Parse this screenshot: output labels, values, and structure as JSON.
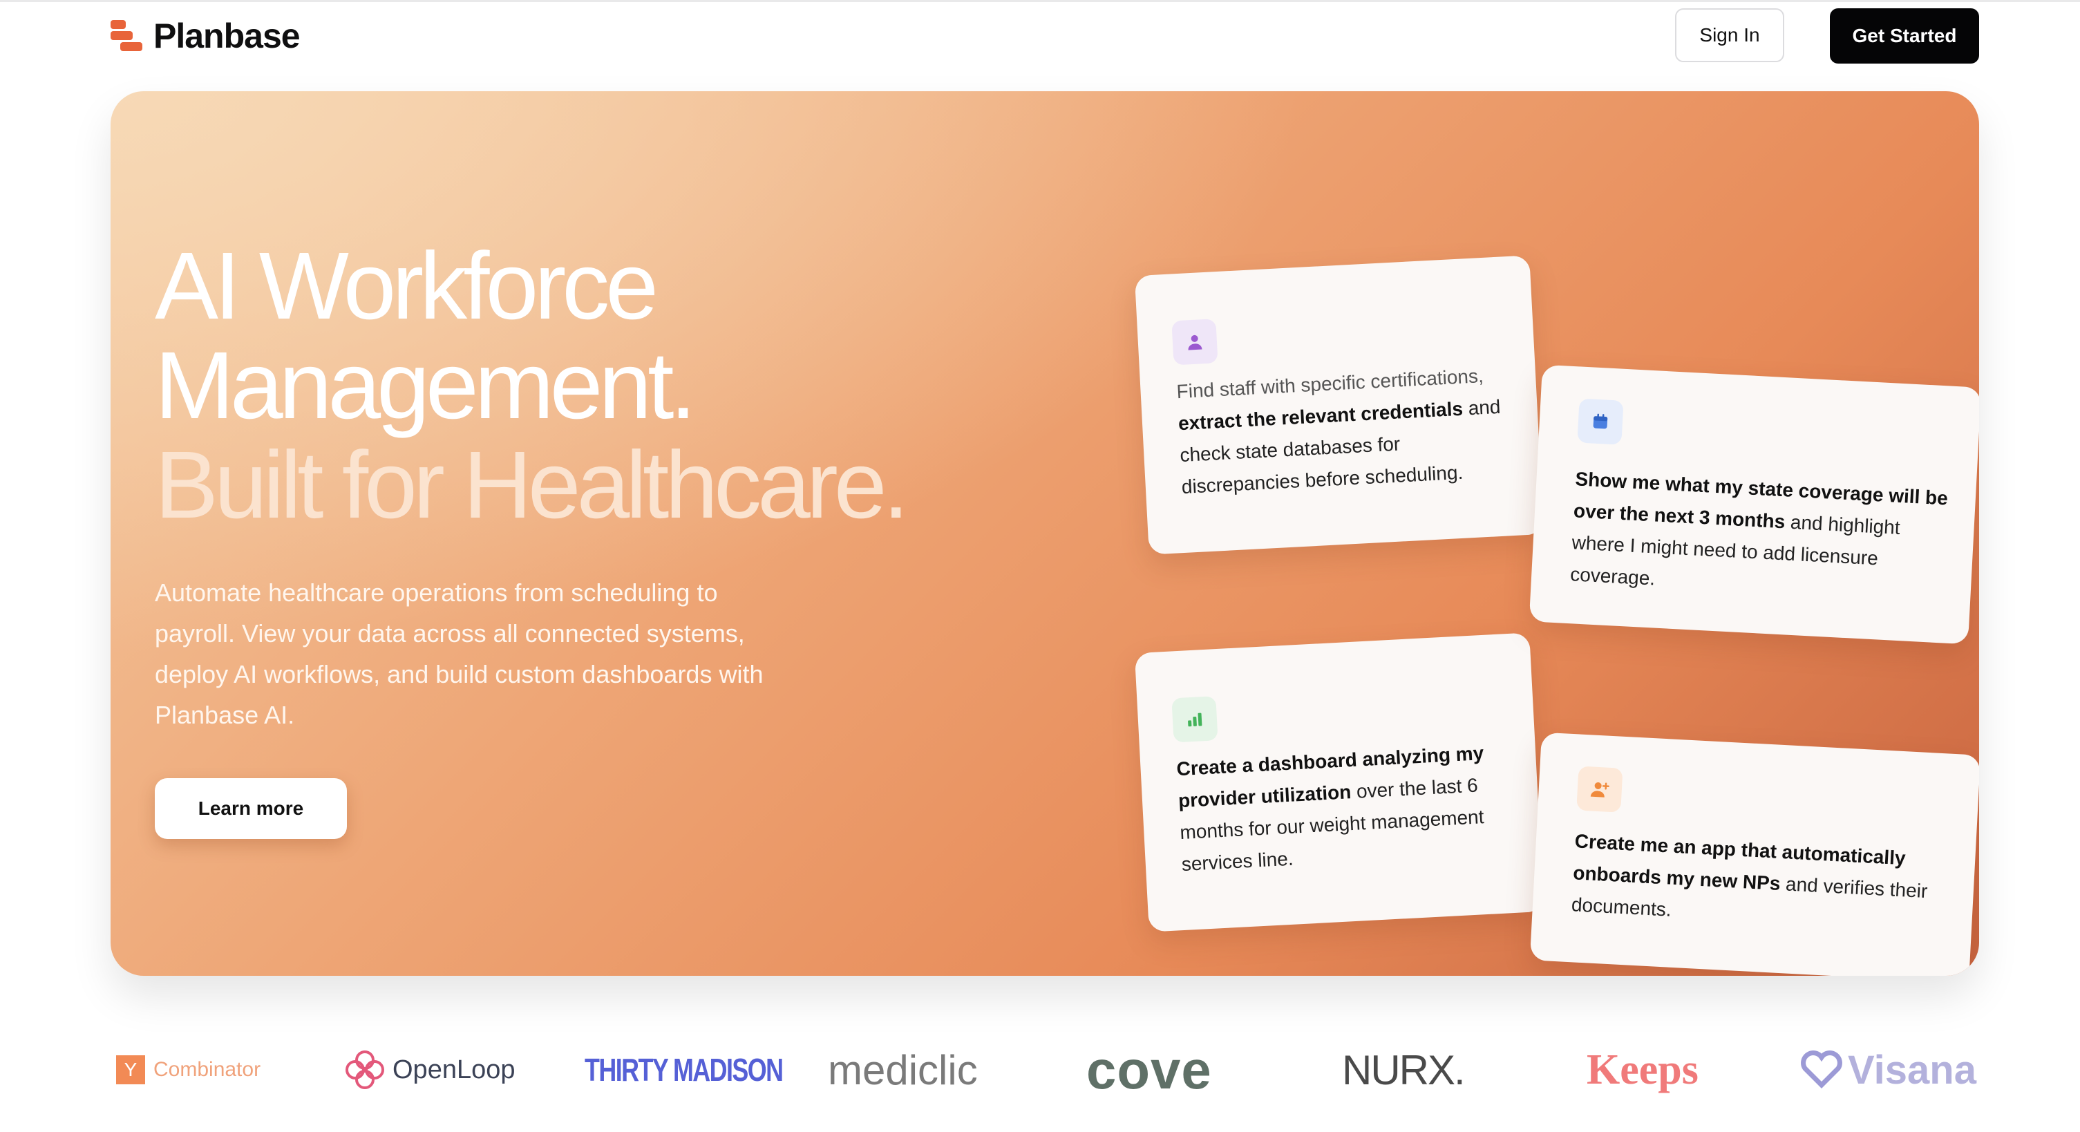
{
  "header": {
    "brand": "Planbase",
    "sign_in": "Sign In",
    "get_started": "Get Started"
  },
  "hero": {
    "headline_1": "AI Workforce",
    "headline_2": "Management.",
    "headline_3": "Built for Healthcare.",
    "subtext": "Automate healthcare operations from scheduling to payroll. View your data across all connected systems, deploy AI workflows, and build custom dashboards with Planbase AI.",
    "cta": "Learn more"
  },
  "cards": [
    {
      "icon": "user-icon",
      "parts": [
        {
          "t": "Find staff with specific certifications, ",
          "b": false
        },
        {
          "t": "extract the relevant credentials",
          "b": true
        },
        {
          "t": " and check state databases for discrepancies before scheduling.",
          "b": false
        }
      ]
    },
    {
      "icon": "calendar-icon",
      "parts": [
        {
          "t": "Show me what my state coverage will be over the next 3 months",
          "b": true
        },
        {
          "t": " and highlight where I might need to add licensure coverage.",
          "b": false
        }
      ]
    },
    {
      "icon": "bar-chart-icon",
      "parts": [
        {
          "t": "Create a dashboard analyzing my provider utilization",
          "b": true
        },
        {
          "t": " over the last 6 months for our weight management services line.",
          "b": false
        }
      ]
    },
    {
      "icon": "user-add-icon",
      "parts": [
        {
          "t": "Create me an app that automatically onboards my new NPs",
          "b": true
        },
        {
          "t": " and verifies their documents.",
          "b": false
        }
      ]
    }
  ],
  "logos": {
    "yc_letter": "Y",
    "yc": "Combinator",
    "openloop": "OpenLoop",
    "thirty_madison": "THIRTY MADISON",
    "mediclic": "mediclic",
    "cove": "cove",
    "nurx": "NURX.",
    "keeps": "Keeps",
    "visana": "Visana"
  },
  "colors": {
    "accent": "#e8643a",
    "hero_start": "#f4c9a0",
    "hero_end": "#c8643f",
    "button_dark": "#050506"
  }
}
